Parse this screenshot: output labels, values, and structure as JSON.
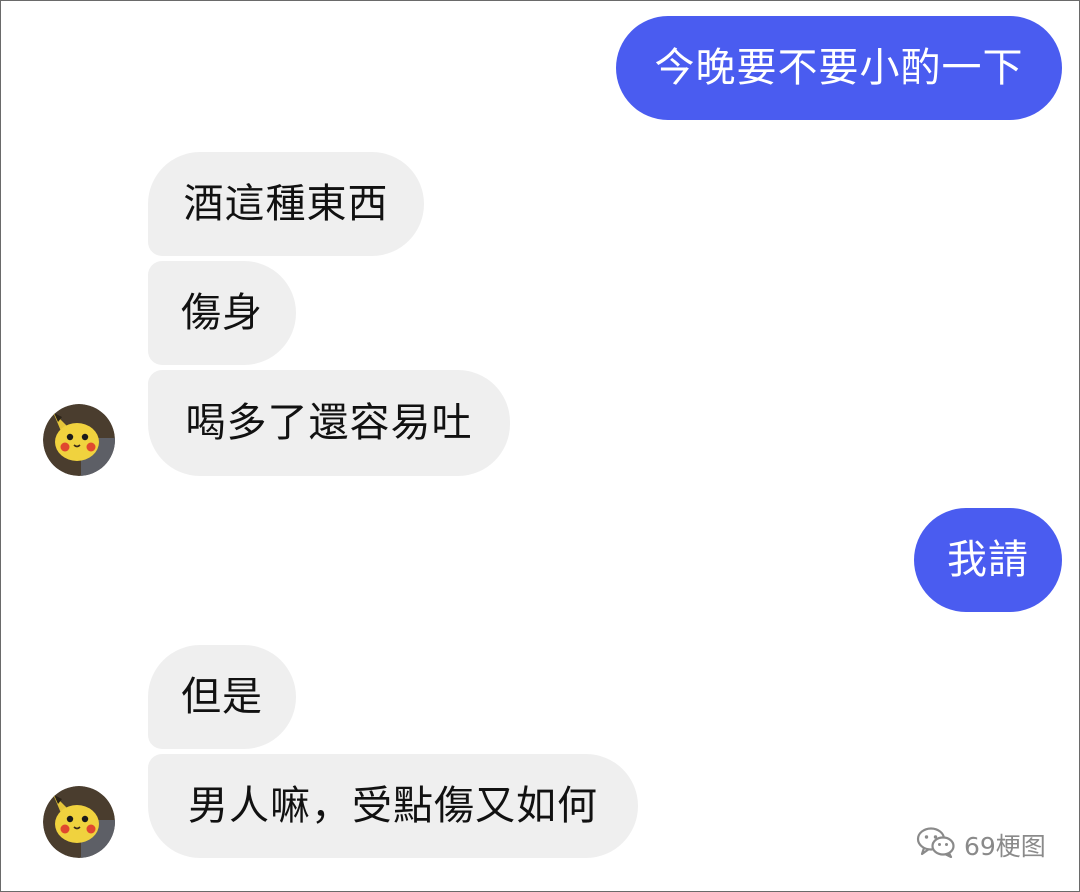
{
  "chat": {
    "messages": [
      {
        "sender": "me",
        "text": "今晚要不要小酌一下"
      },
      {
        "sender": "friend",
        "text": "酒這種東西"
      },
      {
        "sender": "friend",
        "text": "傷身"
      },
      {
        "sender": "friend",
        "text": "喝多了還容易吐"
      },
      {
        "sender": "me",
        "text": "我請"
      },
      {
        "sender": "friend",
        "text": "但是"
      },
      {
        "sender": "friend",
        "text": "男人嘛，受點傷又如何"
      }
    ],
    "friend_avatar_icon": "pikachu-avatar-icon"
  },
  "watermark": {
    "text": "69梗图",
    "icon": "wechat-icon"
  },
  "colors": {
    "outgoing_bubble": "#4a5cf0",
    "incoming_bubble": "#efefef",
    "background": "#ffffff"
  }
}
